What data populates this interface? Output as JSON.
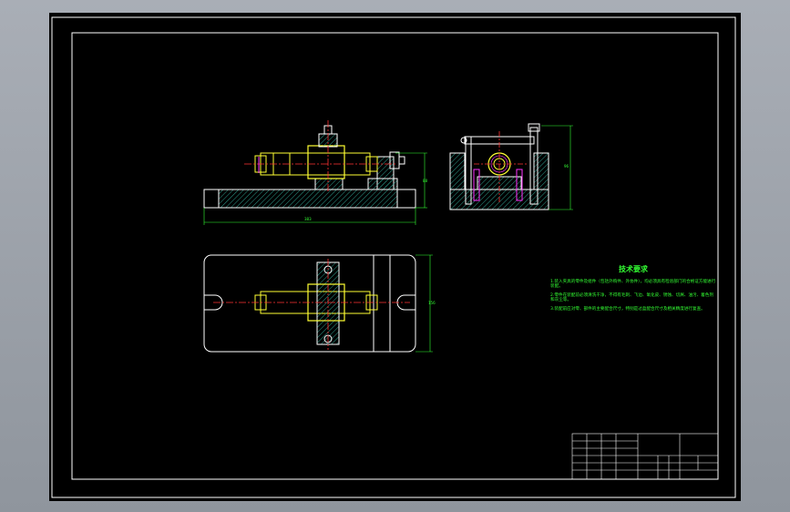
{
  "drawing": {
    "technical_requirements": {
      "title": "技术要求",
      "items": [
        "1.装入夹具的零件及组件（包括外购件、外协件），均必须具有检验部门的合格证方能进行装配。",
        "2.零件在装配前必须清洗干净，不得有毛刺、飞边、氧化皮、锈蚀、切屑、油污、着色剂和灰尘等。",
        "3.装配前应对零、部件的主要配合尺寸，特别是过盈配合尺寸及相关精度进行复查。"
      ]
    },
    "dimensions": {
      "front_length": "383",
      "front_height": "88",
      "side_height": "96",
      "top_width": "156"
    }
  },
  "colors": {
    "background": "#000000",
    "border": "#ffffff",
    "part_outline": "#ffffff",
    "hatch": "#33aa99",
    "highlight": "#ffff33",
    "centerline": "#ff3333",
    "dimension": "#33ff33",
    "accent": "#ff33ff"
  }
}
